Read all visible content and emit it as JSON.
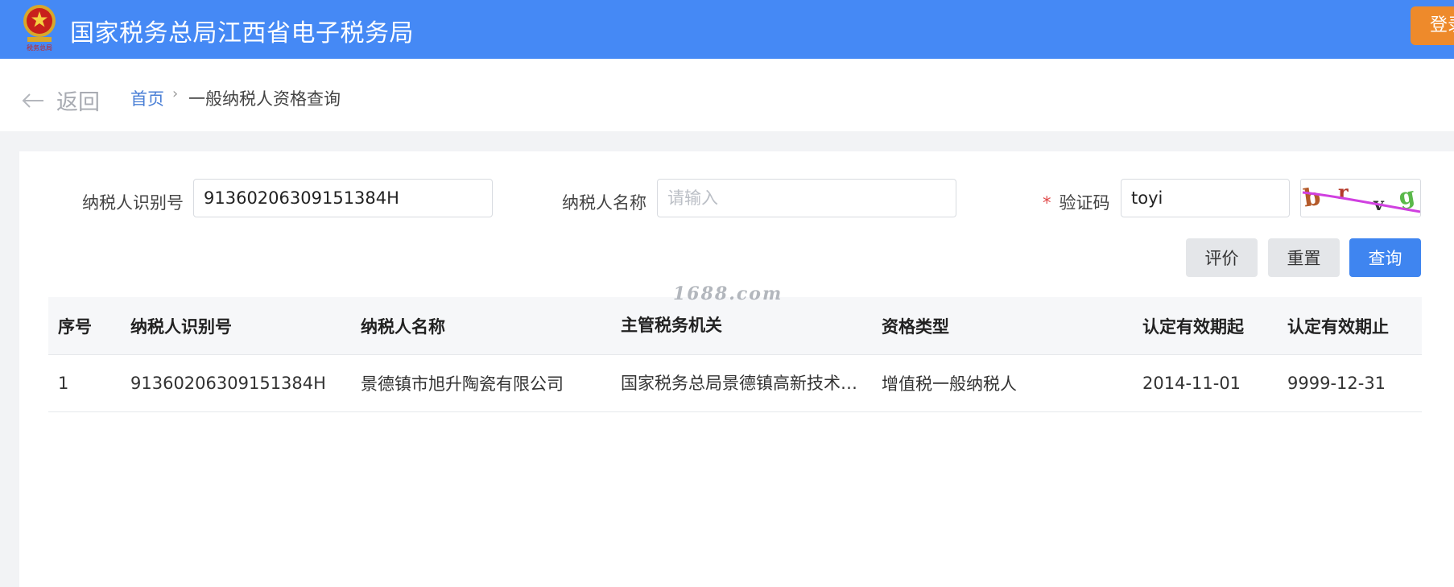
{
  "header": {
    "title": "国家税务总局江西省电子税务局",
    "login_label": "登录",
    "emblem_caption": "税务总局"
  },
  "breadcrumb": {
    "back_label": "返回",
    "home_label": "首页",
    "separator": "›",
    "current_label": "一般纳税人资格查询"
  },
  "form": {
    "taxpayer_id": {
      "label": "纳税人识别号",
      "value": "91360206309151384H",
      "placeholder": ""
    },
    "taxpayer_name": {
      "label": "纳税人名称",
      "value": "",
      "placeholder": "请输入"
    },
    "captcha": {
      "required_mark": "*",
      "label": "验证码",
      "value": "toyi",
      "image_text": "brvg"
    }
  },
  "buttons": {
    "evaluate_label": "评价",
    "reset_label": "重置",
    "query_label": "查询"
  },
  "watermark": "1688.com",
  "table": {
    "headers": [
      "序号",
      "纳税人识别号",
      "纳税人名称",
      "主管税务机关",
      "资格类型",
      "认定有效期起",
      "认定有效期止"
    ],
    "rows": [
      [
        "1",
        "91360206309151384H",
        "景德镇市旭升陶瓷有限公司",
        "国家税务总局景德镇高新技术…",
        "增值税一般纳税人",
        "2014-11-01",
        "9999-12-31"
      ]
    ]
  },
  "colors": {
    "header_bg": "#4589f5",
    "login_bg": "#ee8a2b",
    "primary": "#3f85f0",
    "link": "#4a7fd6"
  }
}
